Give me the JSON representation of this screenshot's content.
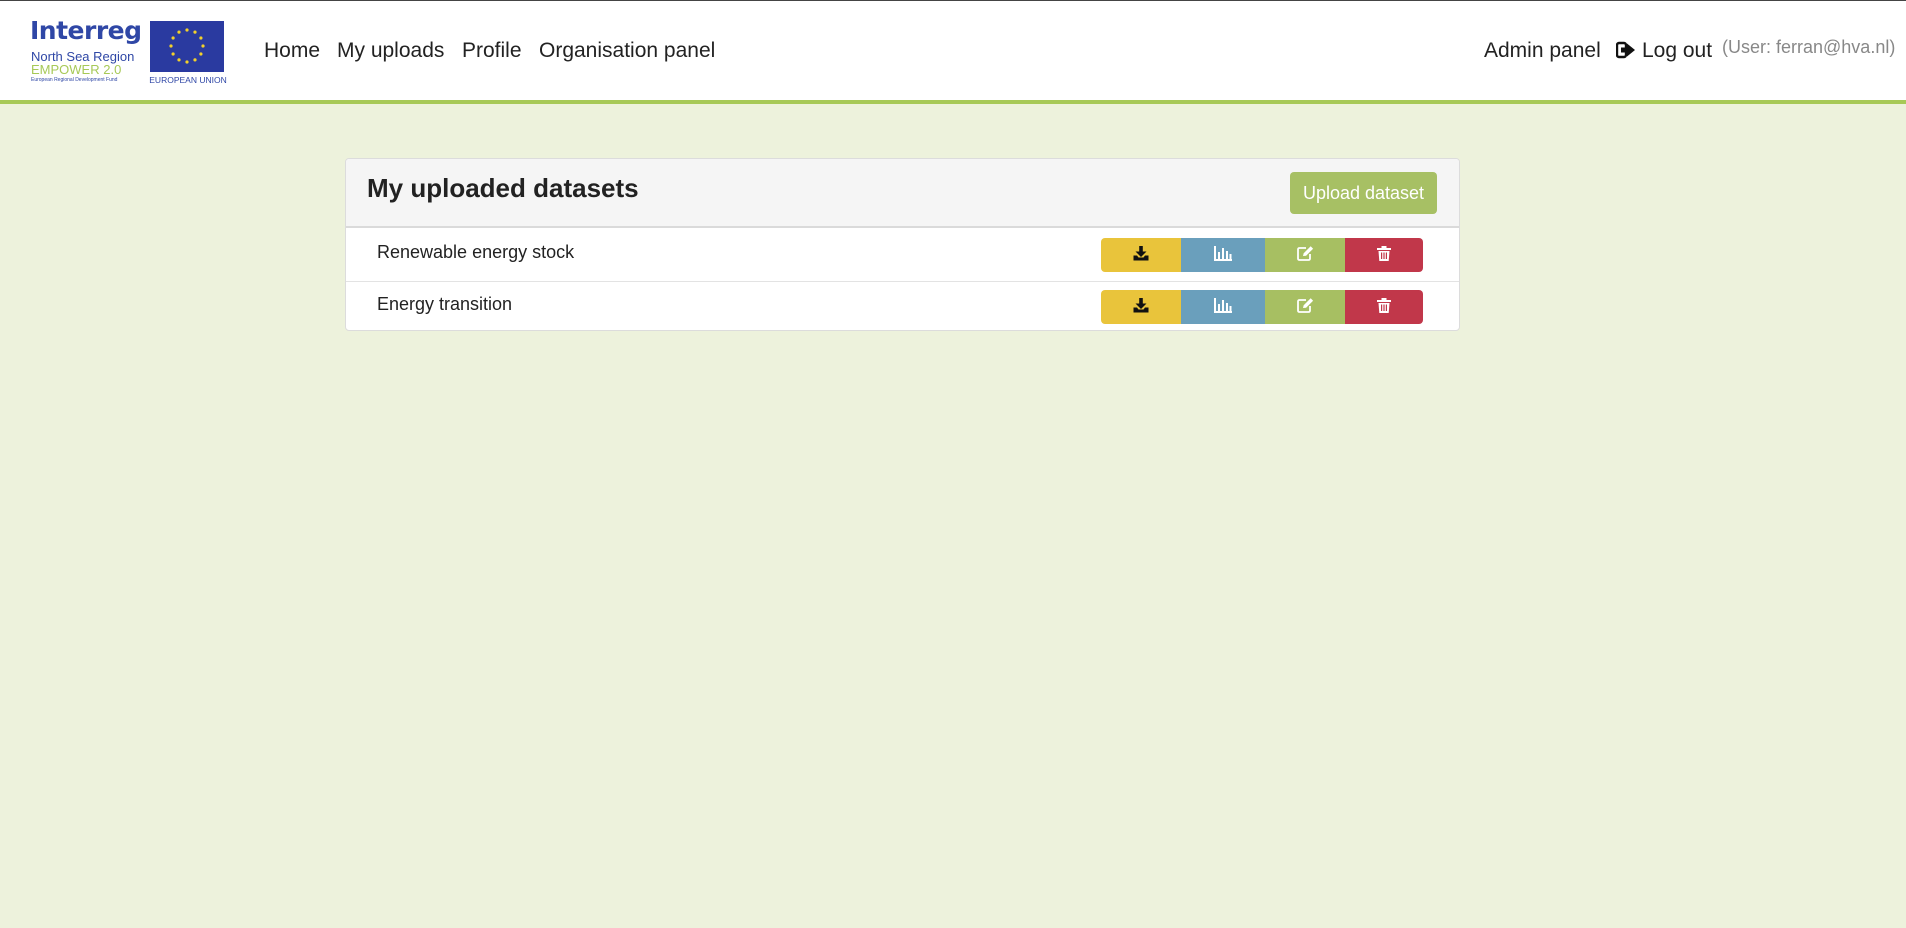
{
  "logo": {
    "word": "Interreg",
    "region": "North Sea Region",
    "program": "EMPOWER 2.0",
    "fund": "European Regional Development Fund",
    "eu": "EUROPEAN UNION"
  },
  "nav": {
    "home": "Home",
    "my_uploads": "My uploads",
    "profile": "Profile",
    "organisation_panel": "Organisation panel",
    "admin_panel": "Admin panel",
    "logout": "Log out",
    "user_info": "(User: ferran@hva.nl)"
  },
  "panel": {
    "title": "My uploaded datasets",
    "upload_button": "Upload dataset"
  },
  "datasets": [
    {
      "name": "Renewable energy stock"
    },
    {
      "name": "Energy transition"
    }
  ],
  "row_actions": [
    {
      "icon": "download-icon",
      "color": "#e9c43b"
    },
    {
      "icon": "bar-chart-icon",
      "color": "#6a9fbc"
    },
    {
      "icon": "edit-icon",
      "color": "#a7bf62"
    },
    {
      "icon": "trash-icon",
      "color": "#c1374a"
    }
  ],
  "colors": {
    "background": "#edf2dc",
    "accent": "#a7c957",
    "upload_button": "#a7c064"
  }
}
